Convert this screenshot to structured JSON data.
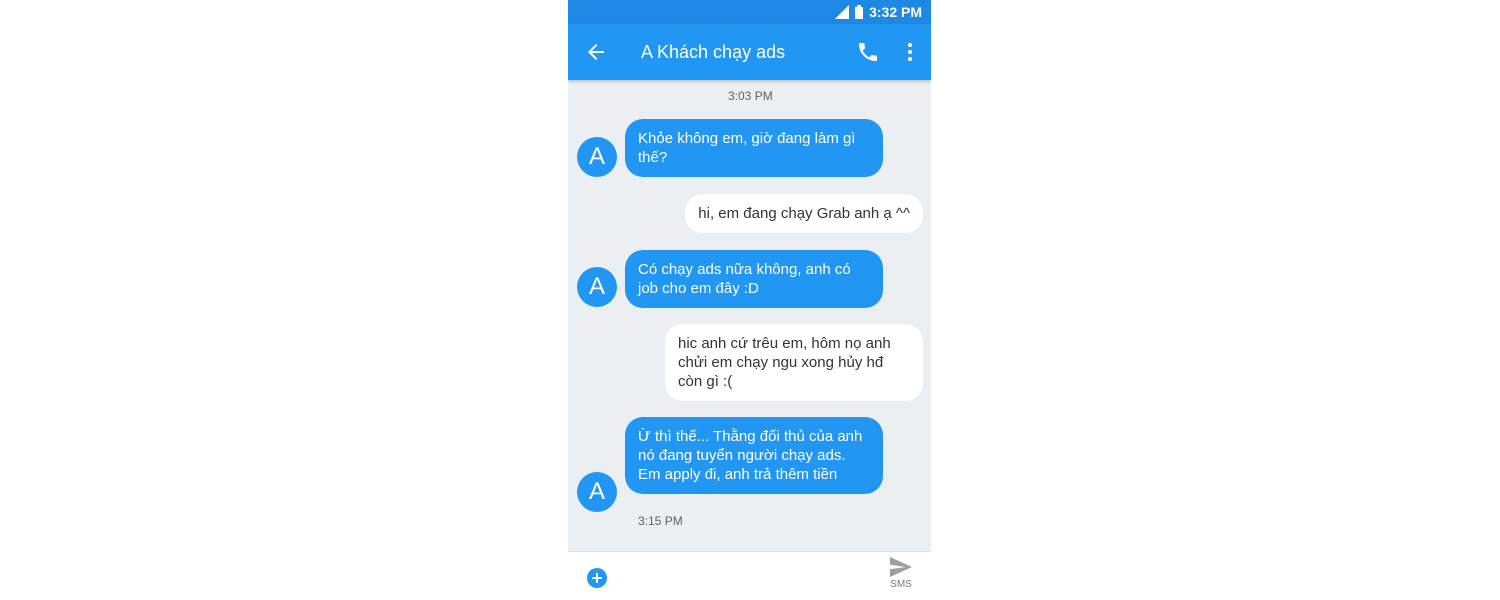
{
  "status_bar": {
    "time": "3:32 PM",
    "signal_icon": "signal-icon",
    "battery_icon": "battery-icon"
  },
  "app_bar": {
    "title": "A Khách chạy ads",
    "back_icon": "arrow-back-icon",
    "call_icon": "phone-icon",
    "more_icon": "more-vert-icon"
  },
  "conversation": {
    "top_timestamp": "3:03 PM",
    "bottom_timestamp": "3:15 PM",
    "avatar_letter": "A",
    "messages": [
      {
        "direction": "incoming",
        "text": "Khỏe không em, giờ đang làm gì thế?"
      },
      {
        "direction": "outgoing",
        "text": "hi, em đang chạy Grab anh ạ ^^"
      },
      {
        "direction": "incoming",
        "text": "Có chạy ads nữa không, anh có job cho em đây :D"
      },
      {
        "direction": "outgoing",
        "text": "hic anh cứ trêu em, hôm nọ anh chửi em chạy ngu xong hủy hđ còn gì :("
      },
      {
        "direction": "incoming",
        "text": "Ừ thì thế... Thằng đối thủ của anh nó đang tuyển người chạy ads. Em apply đi, anh trả thêm tiền"
      }
    ]
  },
  "composer": {
    "placeholder": "",
    "send_label": "SMS",
    "add_icon": "add-circle-icon",
    "send_icon": "send-icon"
  },
  "colors": {
    "accent": "#2196f3",
    "status_bar": "#1e88e5",
    "background": "#eceff1"
  }
}
